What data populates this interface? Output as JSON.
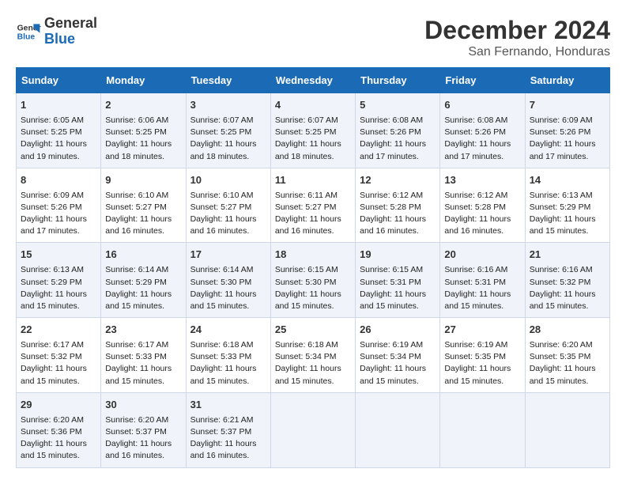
{
  "header": {
    "logo_line1": "General",
    "logo_line2": "Blue",
    "title": "December 2024",
    "subtitle": "San Fernando, Honduras"
  },
  "days_of_week": [
    "Sunday",
    "Monday",
    "Tuesday",
    "Wednesday",
    "Thursday",
    "Friday",
    "Saturday"
  ],
  "weeks": [
    [
      {
        "day": "1",
        "lines": [
          "Sunrise: 6:05 AM",
          "Sunset: 5:25 PM",
          "Daylight: 11 hours",
          "and 19 minutes."
        ]
      },
      {
        "day": "2",
        "lines": [
          "Sunrise: 6:06 AM",
          "Sunset: 5:25 PM",
          "Daylight: 11 hours",
          "and 18 minutes."
        ]
      },
      {
        "day": "3",
        "lines": [
          "Sunrise: 6:07 AM",
          "Sunset: 5:25 PM",
          "Daylight: 11 hours",
          "and 18 minutes."
        ]
      },
      {
        "day": "4",
        "lines": [
          "Sunrise: 6:07 AM",
          "Sunset: 5:25 PM",
          "Daylight: 11 hours",
          "and 18 minutes."
        ]
      },
      {
        "day": "5",
        "lines": [
          "Sunrise: 6:08 AM",
          "Sunset: 5:26 PM",
          "Daylight: 11 hours",
          "and 17 minutes."
        ]
      },
      {
        "day": "6",
        "lines": [
          "Sunrise: 6:08 AM",
          "Sunset: 5:26 PM",
          "Daylight: 11 hours",
          "and 17 minutes."
        ]
      },
      {
        "day": "7",
        "lines": [
          "Sunrise: 6:09 AM",
          "Sunset: 5:26 PM",
          "Daylight: 11 hours",
          "and 17 minutes."
        ]
      }
    ],
    [
      {
        "day": "8",
        "lines": [
          "Sunrise: 6:09 AM",
          "Sunset: 5:26 PM",
          "Daylight: 11 hours",
          "and 17 minutes."
        ]
      },
      {
        "day": "9",
        "lines": [
          "Sunrise: 6:10 AM",
          "Sunset: 5:27 PM",
          "Daylight: 11 hours",
          "and 16 minutes."
        ]
      },
      {
        "day": "10",
        "lines": [
          "Sunrise: 6:10 AM",
          "Sunset: 5:27 PM",
          "Daylight: 11 hours",
          "and 16 minutes."
        ]
      },
      {
        "day": "11",
        "lines": [
          "Sunrise: 6:11 AM",
          "Sunset: 5:27 PM",
          "Daylight: 11 hours",
          "and 16 minutes."
        ]
      },
      {
        "day": "12",
        "lines": [
          "Sunrise: 6:12 AM",
          "Sunset: 5:28 PM",
          "Daylight: 11 hours",
          "and 16 minutes."
        ]
      },
      {
        "day": "13",
        "lines": [
          "Sunrise: 6:12 AM",
          "Sunset: 5:28 PM",
          "Daylight: 11 hours",
          "and 16 minutes."
        ]
      },
      {
        "day": "14",
        "lines": [
          "Sunrise: 6:13 AM",
          "Sunset: 5:29 PM",
          "Daylight: 11 hours",
          "and 15 minutes."
        ]
      }
    ],
    [
      {
        "day": "15",
        "lines": [
          "Sunrise: 6:13 AM",
          "Sunset: 5:29 PM",
          "Daylight: 11 hours",
          "and 15 minutes."
        ]
      },
      {
        "day": "16",
        "lines": [
          "Sunrise: 6:14 AM",
          "Sunset: 5:29 PM",
          "Daylight: 11 hours",
          "and 15 minutes."
        ]
      },
      {
        "day": "17",
        "lines": [
          "Sunrise: 6:14 AM",
          "Sunset: 5:30 PM",
          "Daylight: 11 hours",
          "and 15 minutes."
        ]
      },
      {
        "day": "18",
        "lines": [
          "Sunrise: 6:15 AM",
          "Sunset: 5:30 PM",
          "Daylight: 11 hours",
          "and 15 minutes."
        ]
      },
      {
        "day": "19",
        "lines": [
          "Sunrise: 6:15 AM",
          "Sunset: 5:31 PM",
          "Daylight: 11 hours",
          "and 15 minutes."
        ]
      },
      {
        "day": "20",
        "lines": [
          "Sunrise: 6:16 AM",
          "Sunset: 5:31 PM",
          "Daylight: 11 hours",
          "and 15 minutes."
        ]
      },
      {
        "day": "21",
        "lines": [
          "Sunrise: 6:16 AM",
          "Sunset: 5:32 PM",
          "Daylight: 11 hours",
          "and 15 minutes."
        ]
      }
    ],
    [
      {
        "day": "22",
        "lines": [
          "Sunrise: 6:17 AM",
          "Sunset: 5:32 PM",
          "Daylight: 11 hours",
          "and 15 minutes."
        ]
      },
      {
        "day": "23",
        "lines": [
          "Sunrise: 6:17 AM",
          "Sunset: 5:33 PM",
          "Daylight: 11 hours",
          "and 15 minutes."
        ]
      },
      {
        "day": "24",
        "lines": [
          "Sunrise: 6:18 AM",
          "Sunset: 5:33 PM",
          "Daylight: 11 hours",
          "and 15 minutes."
        ]
      },
      {
        "day": "25",
        "lines": [
          "Sunrise: 6:18 AM",
          "Sunset: 5:34 PM",
          "Daylight: 11 hours",
          "and 15 minutes."
        ]
      },
      {
        "day": "26",
        "lines": [
          "Sunrise: 6:19 AM",
          "Sunset: 5:34 PM",
          "Daylight: 11 hours",
          "and 15 minutes."
        ]
      },
      {
        "day": "27",
        "lines": [
          "Sunrise: 6:19 AM",
          "Sunset: 5:35 PM",
          "Daylight: 11 hours",
          "and 15 minutes."
        ]
      },
      {
        "day": "28",
        "lines": [
          "Sunrise: 6:20 AM",
          "Sunset: 5:35 PM",
          "Daylight: 11 hours",
          "and 15 minutes."
        ]
      }
    ],
    [
      {
        "day": "29",
        "lines": [
          "Sunrise: 6:20 AM",
          "Sunset: 5:36 PM",
          "Daylight: 11 hours",
          "and 15 minutes."
        ]
      },
      {
        "day": "30",
        "lines": [
          "Sunrise: 6:20 AM",
          "Sunset: 5:37 PM",
          "Daylight: 11 hours",
          "and 16 minutes."
        ]
      },
      {
        "day": "31",
        "lines": [
          "Sunrise: 6:21 AM",
          "Sunset: 5:37 PM",
          "Daylight: 11 hours",
          "and 16 minutes."
        ]
      },
      {
        "day": "",
        "lines": []
      },
      {
        "day": "",
        "lines": []
      },
      {
        "day": "",
        "lines": []
      },
      {
        "day": "",
        "lines": []
      }
    ]
  ]
}
